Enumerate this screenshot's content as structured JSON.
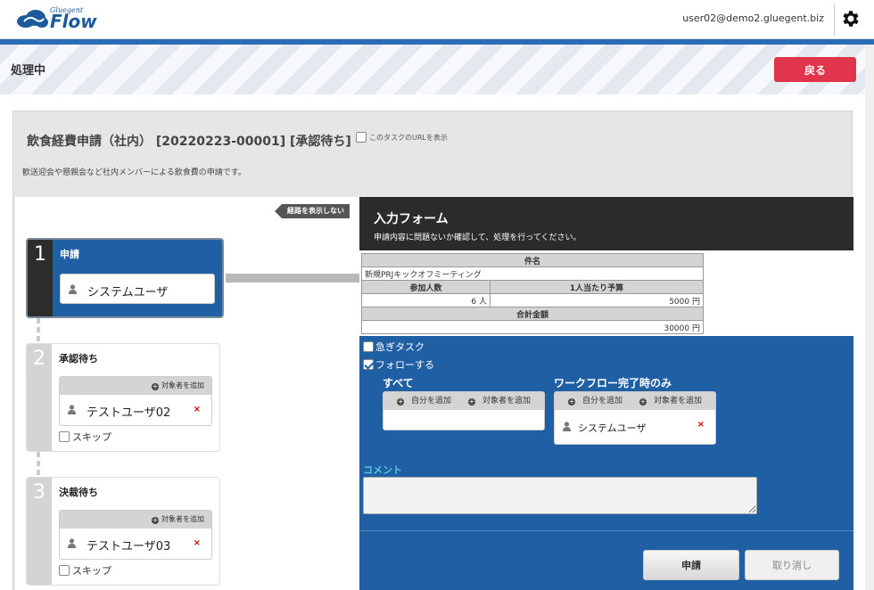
{
  "header": {
    "logo_sub": "Gluegent",
    "logo_main": "Flow",
    "user_email": "user02@demo2.gluegent.biz"
  },
  "band": {
    "title": "処理中",
    "back_label": "戻る"
  },
  "form": {
    "title": "飲食経費申請（社内） [20220223-00001] [承認待ち]",
    "show_url_label": "このタスクのURLを表示",
    "description": "歓送迎会や懇親会など社内メンバーによる飲食費の申請です。"
  },
  "route": {
    "hide_label": "経路を表示しない",
    "add_target_label": "対象者を追加",
    "skip_label": "スキップ",
    "steps": [
      {
        "num": "1",
        "title": "申請",
        "assignee": "システムユーザ"
      },
      {
        "num": "2",
        "title": "承認待ち",
        "assignee": "テストユーザ02"
      },
      {
        "num": "3",
        "title": "決裁待ち",
        "assignee": "テストユーザ03"
      }
    ]
  },
  "input_form": {
    "title": "入力フォーム",
    "subtitle": "申請内容に問題ないか確認して、処理を行ってください。",
    "subject_label": "件名",
    "subject_value": "新規PRJキックオフミーティング",
    "participants_label": "参加人数",
    "participants_value": "6",
    "participants_unit": "人",
    "budget_label": "1人当たり予算",
    "budget_value": "5000",
    "budget_unit": "円",
    "total_label": "合計金額",
    "total_value": "30000",
    "total_unit": "円"
  },
  "options": {
    "urgent_label": "急ぎタスク",
    "follow_label": "フォローする",
    "all_title": "すべて",
    "complete_title": "ワークフロー完了時のみ",
    "add_self_label": "自分を追加",
    "add_target_label": "対象者を追加",
    "complete_person": "システムユーザ"
  },
  "comment": {
    "label": "コメント"
  },
  "buttons": {
    "submit": "申請",
    "withdraw": "取り消し"
  },
  "colors": {
    "brand_blue": "#1f5fa3",
    "back_red": "#e0354a",
    "dark_header": "#2b2b2b"
  }
}
